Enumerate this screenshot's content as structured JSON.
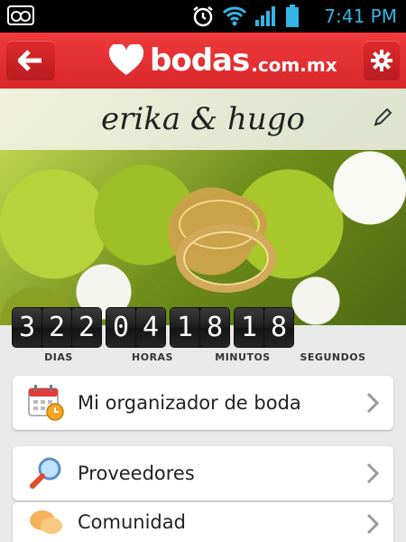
{
  "status_bar": {
    "time": "7:41 PM",
    "icons": [
      "voicemail-icon",
      "alarm-icon",
      "wifi-icon",
      "signal-icon",
      "battery-icon"
    ],
    "accent_color": "#33b5e5"
  },
  "header": {
    "logo_word": "bodas",
    "logo_domain": ".com.mx",
    "brand_color": "#e8302f"
  },
  "hero": {
    "names": "erika & hugo"
  },
  "countdown": {
    "days": [
      "3",
      "2",
      "2"
    ],
    "hours": [
      "0",
      "4"
    ],
    "minutes": [
      "1",
      "8"
    ],
    "seconds": [
      "1",
      "8"
    ],
    "labels": {
      "days": "DIAS",
      "hours": "HORAS",
      "minutes": "MINUTOS",
      "seconds": "SEGUNDOS"
    }
  },
  "menu": [
    {
      "label": "Mi organizador de boda",
      "icon": "calendar-clock-icon"
    },
    {
      "label": "Proveedores",
      "icon": "magnifier-icon"
    },
    {
      "label": "Comunidad",
      "icon": "chat-bubbles-icon"
    }
  ]
}
